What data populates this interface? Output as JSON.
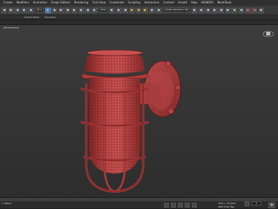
{
  "menubar": {
    "items": [
      "Create",
      "Modifiers",
      "Animation",
      "Graph Editors",
      "Rendering",
      "Civil View",
      "Customize",
      "Scripting",
      "Interactive",
      "Content",
      "Arnold",
      "Help",
      "SIGNERS",
      "MeshTools"
    ]
  },
  "toolbar": {
    "view_dropdown": "View",
    "selection_set": "Create Selection Set"
  },
  "ribbon": {
    "tabs": [
      "Object Paint",
      "Populate"
    ]
  },
  "viewport": {
    "label": "[Perspective]",
    "colors": {
      "model": "#c04848",
      "wire": "#6a1a1a",
      "background": "#3a3a3a"
    }
  },
  "statusbar": {
    "status": "1 Object",
    "grid": "Grid = 10.0cm",
    "add_time_tag": "Add Time Tag",
    "frame": "0"
  }
}
